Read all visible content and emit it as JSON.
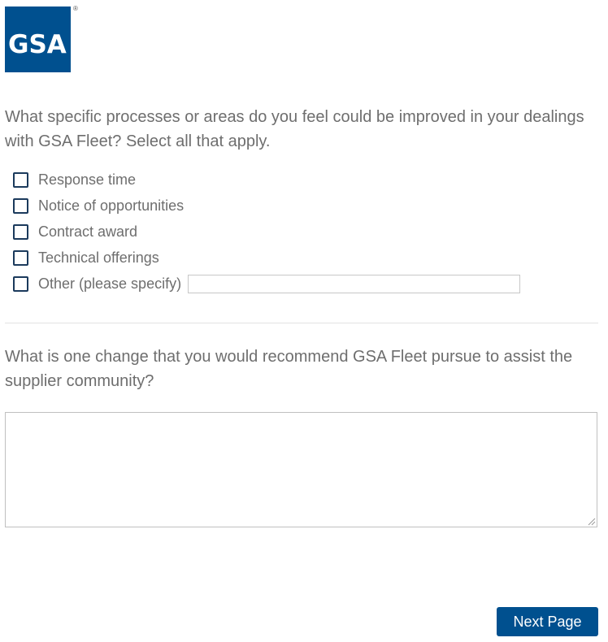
{
  "logo": {
    "text": "GSA",
    "registered": "®"
  },
  "question1": {
    "text": "What specific processes or areas do you feel could be improved in your dealings with GSA Fleet? Select all that apply.",
    "options": [
      {
        "label": "Response time",
        "checked": false
      },
      {
        "label": "Notice of opportunities",
        "checked": false
      },
      {
        "label": "Contract award",
        "checked": false
      },
      {
        "label": "Technical offerings",
        "checked": false
      },
      {
        "label": "Other (please specify)",
        "checked": false
      }
    ],
    "other_value": ""
  },
  "question2": {
    "text": "What is one change that you would recommend GSA Fleet pursue to assist the supplier community?",
    "answer_value": ""
  },
  "buttons": {
    "next_label": "Next Page"
  },
  "colors": {
    "brand": "#00508f",
    "text": "#6e6e6e",
    "checkbox_border": "#1b3a5c"
  }
}
